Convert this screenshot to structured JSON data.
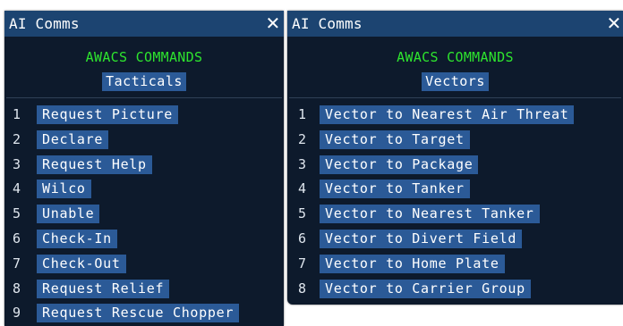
{
  "left_window": {
    "title": "AI Comms",
    "close": "✕",
    "header": "AWACS COMMANDS",
    "subheader": "Tacticals",
    "items": [
      {
        "number": "1",
        "label": "Request Picture"
      },
      {
        "number": "2",
        "label": "Declare"
      },
      {
        "number": "3",
        "label": "Request Help"
      },
      {
        "number": "4",
        "label": "Wilco"
      },
      {
        "number": "5",
        "label": "Unable"
      },
      {
        "number": "6",
        "label": "Check-In"
      },
      {
        "number": "7",
        "label": "Check-Out"
      },
      {
        "number": "8",
        "label": "Request Relief"
      },
      {
        "number": "9",
        "label": "Request Rescue Chopper"
      }
    ]
  },
  "right_window": {
    "title": "AI Comms",
    "close": "✕",
    "header": "AWACS COMMANDS",
    "subheader": "Vectors",
    "items": [
      {
        "number": "1",
        "label": "Vector to Nearest Air Threat"
      },
      {
        "number": "2",
        "label": "Vector to Target"
      },
      {
        "number": "3",
        "label": "Vector to Package"
      },
      {
        "number": "4",
        "label": "Vector to Tanker"
      },
      {
        "number": "5",
        "label": "Vector to Nearest Tanker"
      },
      {
        "number": "6",
        "label": "Vector to Divert Field"
      },
      {
        "number": "7",
        "label": "Vector to Home Plate"
      },
      {
        "number": "8",
        "label": "Vector to Carrier Group"
      }
    ]
  },
  "colors": {
    "panel_bg": "#0d1a2c",
    "titlebar_bg": "#1c4471",
    "item_bg": "#2b5a97",
    "header_text": "#2ee52e",
    "text": "#ffffff"
  },
  "icons": {
    "close": "close-icon"
  }
}
